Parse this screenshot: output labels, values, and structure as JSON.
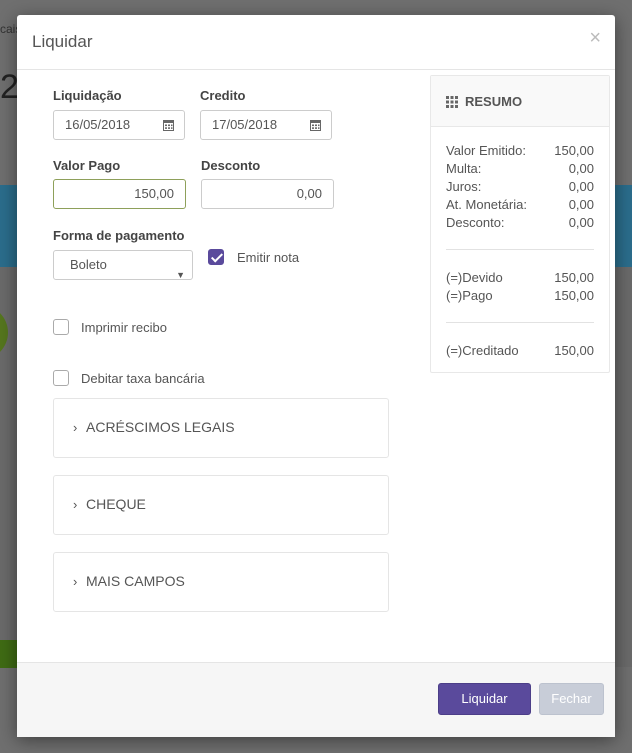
{
  "background": {
    "fragment_top": "cais",
    "fragment_big": "2"
  },
  "modal": {
    "title": "Liquidar",
    "close_symbol": "×"
  },
  "form": {
    "liquidacao_label": "Liquidação",
    "liquidacao_value": "16/05/2018",
    "credito_label": "Credito",
    "credito_value": "17/05/2018",
    "valor_pago_label": "Valor Pago",
    "valor_pago_value": "150,00",
    "desconto_label": "Desconto",
    "desconto_value": "0,00",
    "forma_pagamento_label": "Forma de pagamento",
    "forma_pagamento_value": "Boleto",
    "emitir_nota_label": "Emitir nota",
    "emitir_nota_checked": true,
    "imprimir_recibo_label": "Imprimir recibo",
    "imprimir_recibo_checked": false,
    "debitar_taxa_label": "Debitar taxa bancária",
    "debitar_taxa_checked": false
  },
  "panels": [
    {
      "title": "ACRÉSCIMOS LEGAIS"
    },
    {
      "title": "CHEQUE"
    },
    {
      "title": "MAIS CAMPOS"
    }
  ],
  "resumo": {
    "title": "RESUMO",
    "rows": [
      {
        "label": "Valor Emitido:",
        "value": "150,00"
      },
      {
        "label": "Multa:",
        "value": "0,00"
      },
      {
        "label": "Juros:",
        "value": "0,00"
      },
      {
        "label": "At. Monetária:",
        "value": "0,00"
      },
      {
        "label": "Desconto:",
        "value": "0,00"
      }
    ],
    "totals": [
      {
        "label": "(=)Devido",
        "value": "150,00"
      },
      {
        "label": "(=)Pago",
        "value": "150,00"
      }
    ],
    "final": {
      "label": "(=)Creditado",
      "value": "150,00"
    }
  },
  "footer": {
    "primary_label": "Liquidar",
    "secondary_label": "Fechar"
  },
  "colors": {
    "primary": "#5a4a9c",
    "secondary_disabled": "#c8cdd8",
    "focused_border": "#8ea05a",
    "backdrop_blue": "#2b6d8c"
  }
}
